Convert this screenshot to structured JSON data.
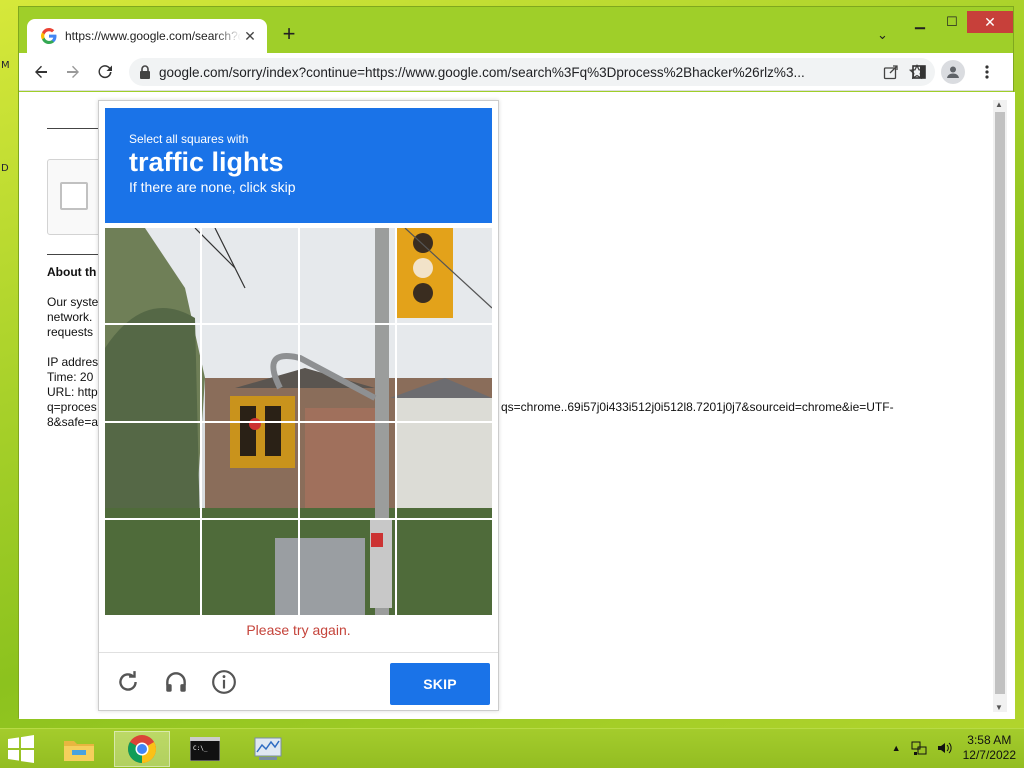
{
  "browser": {
    "tab_title": "https://www.google.com/search?q=process+hacker",
    "tab_close": "✕",
    "new_tab": "+",
    "tab_list": "⌄",
    "window_controls": {
      "minimize": "▁",
      "maximize": "☐",
      "close": "✕"
    },
    "url": "google.com/sorry/index?continue=https://www.google.com/search%3Fq%3Dprocess%2Bhacker%26rlz%3..."
  },
  "page": {
    "about_heading": "About th",
    "para_lines": [
      "Our syste",
      "network.",
      "requests"
    ],
    "info_lines": [
      "IP addres",
      "Time: 20",
      "URL: http",
      "q=proces",
      "8&safe=a"
    ],
    "url_tail": "qs=chrome..69i57j0i433i512j0i512l8.7201j0j7&sourceid=chrome&ie=UTF-",
    "url_tail2": "8"
  },
  "captcha": {
    "sub": "Select all squares with",
    "target": "traffic lights",
    "hint": "If there are none, click skip",
    "error": "Please try again.",
    "skip_label": "SKIP"
  },
  "taskbar": {
    "time": "3:58 AM",
    "date": "12/7/2022"
  },
  "colors": {
    "accent": "#1a73e8",
    "error": "#c5443b",
    "desktop": "#9fcf29"
  },
  "icons": [
    "google-favicon",
    "back-icon",
    "forward-icon",
    "reload-icon",
    "lock-icon",
    "share-icon",
    "star-icon",
    "sidepanel-icon",
    "profile-icon",
    "menu-icon",
    "refresh-icon",
    "audio-icon",
    "info-icon",
    "windows-start-icon",
    "file-explorer-icon",
    "chrome-icon",
    "cmd-icon",
    "perfmon-icon",
    "network-icon",
    "volume-icon"
  ]
}
